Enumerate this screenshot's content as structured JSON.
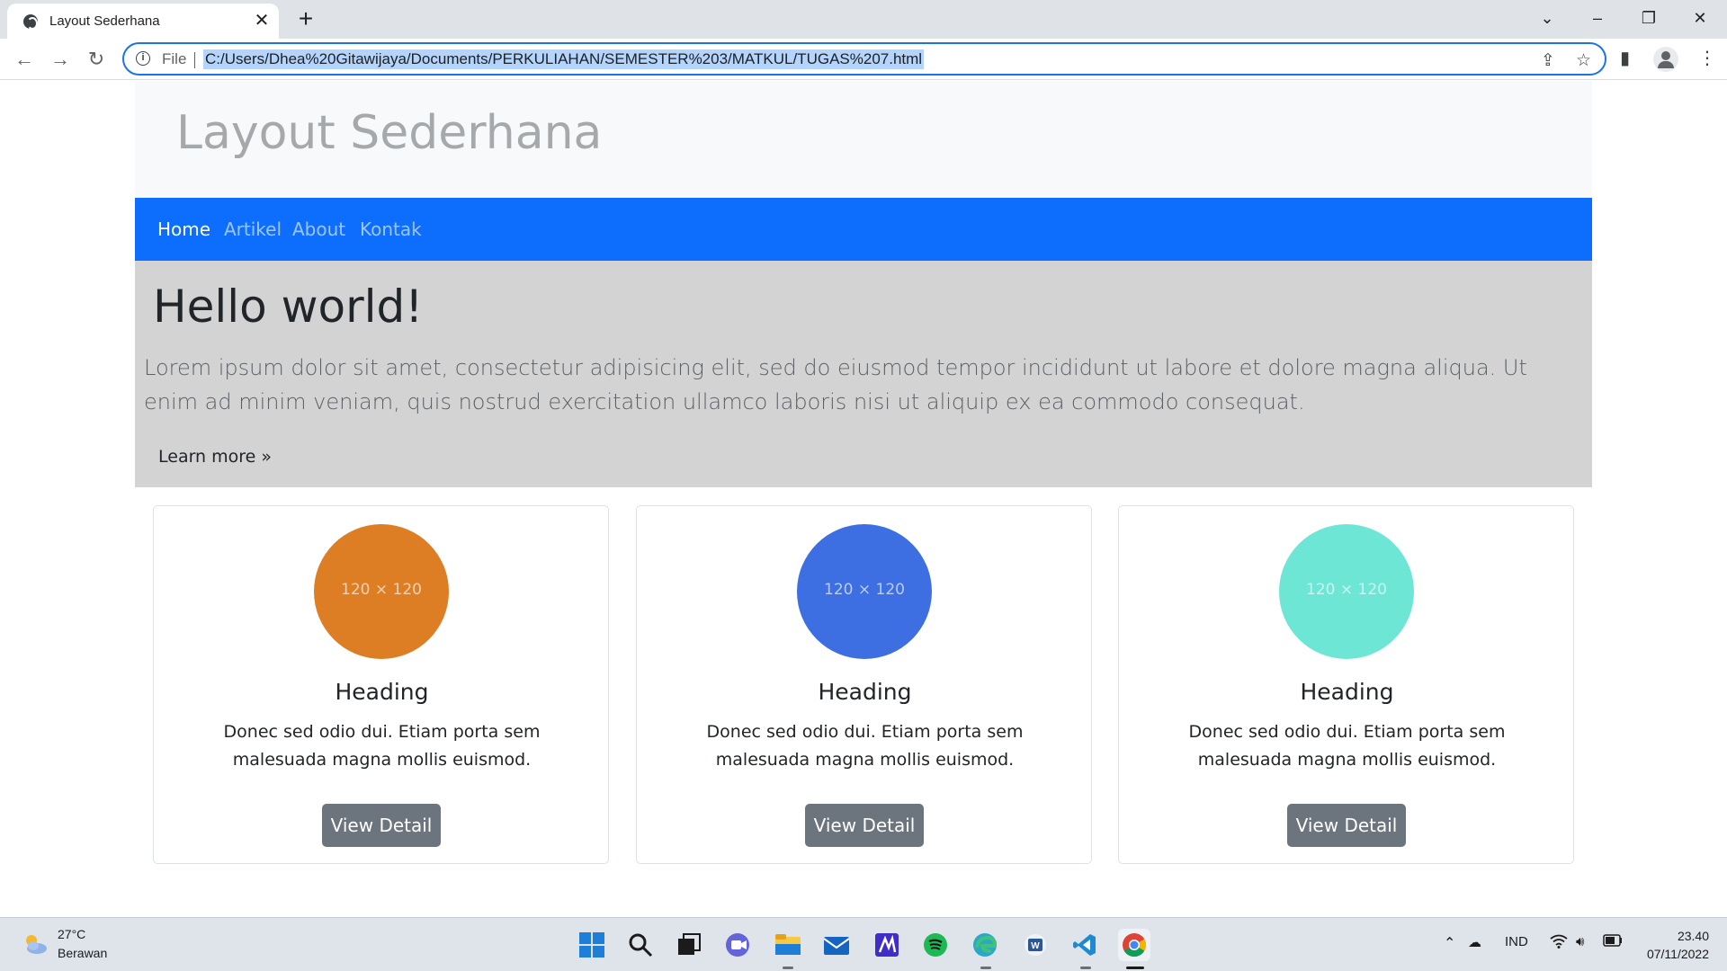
{
  "browser": {
    "tab_title": "Layout Sederhana",
    "new_tab_label": "+",
    "tab_close_label": "✕",
    "address_scheme": "File",
    "url": "C:/Users/Dhea%20Gitawijaya/Documents/PERKULIAHAN/SEMESTER%203/MATKUL/TUGAS%207.html"
  },
  "site": {
    "title": "Layout Sederhana",
    "nav": [
      {
        "label": "Home",
        "active": true
      },
      {
        "label": "Artikel",
        "active": false
      },
      {
        "label": "About",
        "active": false
      },
      {
        "label": "Kontak",
        "active": false
      }
    ]
  },
  "jumbotron": {
    "title": "Hello world!",
    "text": "Lorem ipsum dolor sit amet, consectetur adipisicing elit, sed do eiusmod tempor incididunt ut labore et dolore magna aliqua. Ut enim ad minim veniam, quis nostrud exercitation ullamco laboris nisi ut aliquip ex ea commodo consequat.",
    "link": "Learn more »"
  },
  "cards": [
    {
      "image_label": "120 × 120",
      "color": "#dd7d24",
      "heading": "Heading",
      "text": "Donec sed odio dui. Etiam porta sem malesuada magna mollis euismod.",
      "button": "View Detail"
    },
    {
      "image_label": "120 × 120",
      "color": "#3d6fe2",
      "heading": "Heading",
      "text": "Donec sed odio dui. Etiam porta sem malesuada magna mollis euismod.",
      "button": "View Detail"
    },
    {
      "image_label": "120 × 120",
      "color": "#6ee6d6",
      "heading": "Heading",
      "text": "Donec sed odio dui. Etiam porta sem malesuada magna mollis euismod.",
      "button": "View Detail"
    }
  ],
  "taskbar": {
    "weather_temp": "27°C",
    "weather_desc": "Berawan",
    "language": "IND",
    "time": "23.40",
    "date": "07/11/2022",
    "apps": [
      "start-icon",
      "search-icon",
      "task-view-icon",
      "teams-icon",
      "file-explorer-icon",
      "mail-icon",
      "app-icon",
      "spotify-icon",
      "edge-icon",
      "word-icon",
      "vscode-icon",
      "chrome-icon"
    ]
  },
  "colors": {
    "navbar": "#0d6efd",
    "jumbotron": "#d3d3d3",
    "button": "#6c757d",
    "header": "#f8f9fa"
  }
}
